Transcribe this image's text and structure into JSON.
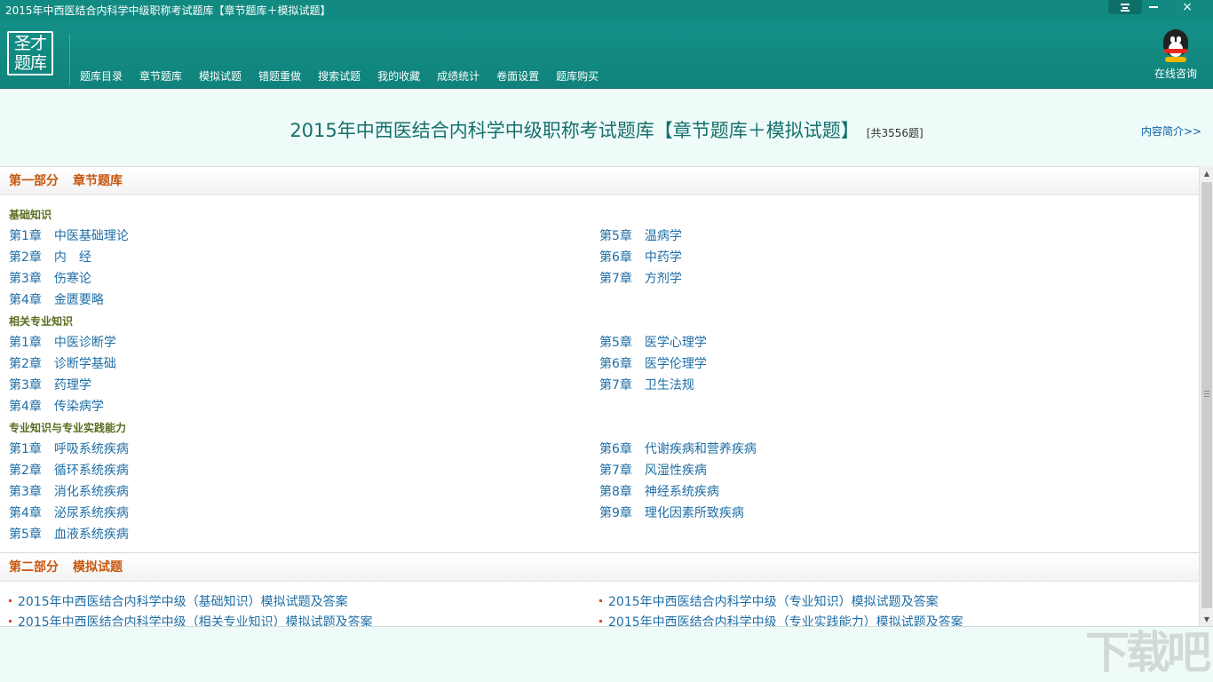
{
  "window": {
    "title": "2015年中西医结合内科学中级职称考试题库【章节题库＋模拟试题】",
    "controls": {
      "menu": "menu-icon",
      "minimize": "minimize-icon",
      "close": "×"
    }
  },
  "toolbar": {
    "logo_line1": "圣才",
    "logo_line2": "题库",
    "nav": [
      "题库目录",
      "章节题库",
      "模拟试题",
      "错题重做",
      "搜索试题",
      "我的收藏",
      "成绩统计",
      "卷面设置",
      "题库购买"
    ],
    "consult_label": "在线咨询",
    "consult_icon": "qq-penguin-icon"
  },
  "header": {
    "title": "2015年中西医结合内科学中级职称考试题库【章节题库＋模拟试题】",
    "count": "[共3556题]",
    "intro_link": "内容简介>>"
  },
  "part1": {
    "num": "第一部分",
    "name": "章节题库",
    "groups": [
      {
        "title": "基础知识",
        "left": [
          {
            "num": "第1章",
            "name": "中医基础理论"
          },
          {
            "num": "第2章",
            "name": "内　经"
          },
          {
            "num": "第3章",
            "name": "伤寒论"
          },
          {
            "num": "第4章",
            "name": "金匮要略"
          }
        ],
        "right": [
          {
            "num": "第5章",
            "name": "温病学"
          },
          {
            "num": "第6章",
            "name": "中药学"
          },
          {
            "num": "第7章",
            "name": "方剂学"
          }
        ]
      },
      {
        "title": "相关专业知识",
        "left": [
          {
            "num": "第1章",
            "name": "中医诊断学"
          },
          {
            "num": "第2章",
            "name": "诊断学基础"
          },
          {
            "num": "第3章",
            "name": "药理学"
          },
          {
            "num": "第4章",
            "name": "传染病学"
          }
        ],
        "right": [
          {
            "num": "第5章",
            "name": "医学心理学"
          },
          {
            "num": "第6章",
            "name": "医学伦理学"
          },
          {
            "num": "第7章",
            "name": "卫生法规"
          }
        ]
      },
      {
        "title": "专业知识与专业实践能力",
        "left": [
          {
            "num": "第1章",
            "name": "呼吸系统疾病"
          },
          {
            "num": "第2章",
            "name": "循环系统疾病"
          },
          {
            "num": "第3章",
            "name": "消化系统疾病"
          },
          {
            "num": "第4章",
            "name": "泌尿系统疾病"
          },
          {
            "num": "第5章",
            "name": "血液系统疾病"
          }
        ],
        "right": [
          {
            "num": "第6章",
            "name": "代谢疾病和营养疾病"
          },
          {
            "num": "第7章",
            "name": "风湿性疾病"
          },
          {
            "num": "第8章",
            "name": "神经系统疾病"
          },
          {
            "num": "第9章",
            "name": "理化因素所致疾病"
          }
        ]
      }
    ]
  },
  "part2": {
    "num": "第二部分",
    "name": "模拟试题",
    "left": [
      "2015年中西医结合内科学中级（基础知识）模拟试题及答案",
      "2015年中西医结合内科学中级（相关专业知识）模拟试题及答案"
    ],
    "right": [
      "2015年中西医结合内科学中级（专业知识）模拟试题及答案",
      "2015年中西医结合内科学中级（专业实践能力）模拟试题及答案"
    ]
  },
  "watermark": "下载吧"
}
